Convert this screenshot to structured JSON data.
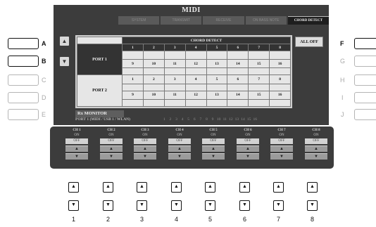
{
  "screen": {
    "title": "MIDI",
    "tabs": [
      "SYSTEM",
      "TRANSMIT",
      "RECEIVE",
      "ON BASS NOTE",
      "CHORD DETECT"
    ],
    "active_tab": "CHORD DETECT",
    "nav_up_icon": "triangle-up",
    "nav_down_icon": "triangle-down",
    "table": {
      "title": "CHORD DETECT",
      "ports": [
        {
          "label": "PORT 1",
          "channels_row1": [
            "1",
            "2",
            "3",
            "4",
            "5",
            "6",
            "7",
            "8"
          ],
          "channels_row2": [
            "9",
            "10",
            "11",
            "12",
            "13",
            "14",
            "15",
            "16"
          ]
        },
        {
          "label": "PORT 2",
          "channels_row1": [
            "1",
            "2",
            "3",
            "4",
            "5",
            "6",
            "7",
            "8"
          ],
          "channels_row2": [
            "9",
            "10",
            "11",
            "12",
            "13",
            "14",
            "15",
            "16"
          ]
        }
      ]
    },
    "all_off_label": "ALL OFF",
    "rx_monitor": {
      "label": "Rx MONITOR",
      "port_line": "PORT 1 (MIDI / USB 1 / WLAN)",
      "numbers": [
        "1",
        "2",
        "3",
        "4",
        "5",
        "6",
        "7",
        "8",
        "9",
        "10",
        "11",
        "12",
        "13",
        "14",
        "15",
        "16"
      ]
    }
  },
  "channels": [
    {
      "label": "CH 1",
      "state": "ON",
      "value": "OFF"
    },
    {
      "label": "CH 2",
      "state": "ON",
      "value": "OFF"
    },
    {
      "label": "CH 3",
      "state": "ON",
      "value": "OFF"
    },
    {
      "label": "CH 4",
      "state": "ON",
      "value": "OFF"
    },
    {
      "label": "CH 5",
      "state": "ON",
      "value": "OFF"
    },
    {
      "label": "CH 6",
      "state": "ON",
      "value": "OFF"
    },
    {
      "label": "CH 7",
      "state": "ON",
      "value": "OFF"
    },
    {
      "label": "CH 8",
      "state": "ON",
      "value": "OFF"
    }
  ],
  "left_buttons": [
    {
      "letter": "A",
      "active": true
    },
    {
      "letter": "B",
      "active": true
    },
    {
      "letter": "C",
      "active": false
    },
    {
      "letter": "D",
      "active": false
    },
    {
      "letter": "E",
      "active": false
    }
  ],
  "right_buttons": [
    {
      "letter": "F",
      "active": true
    },
    {
      "letter": "G",
      "active": false
    },
    {
      "letter": "H",
      "active": false
    },
    {
      "letter": "I",
      "active": false
    },
    {
      "letter": "J",
      "active": false
    }
  ],
  "physical_channel_buttons": {
    "up_glyph": "▲",
    "down_glyph": "▼",
    "numbers": [
      "1",
      "2",
      "3",
      "4",
      "5",
      "6",
      "7",
      "8"
    ]
  },
  "colors": {
    "screen_bg": "#3c3c3c",
    "cell_bg": "#e6e6e6",
    "header_bg": "#333333"
  }
}
